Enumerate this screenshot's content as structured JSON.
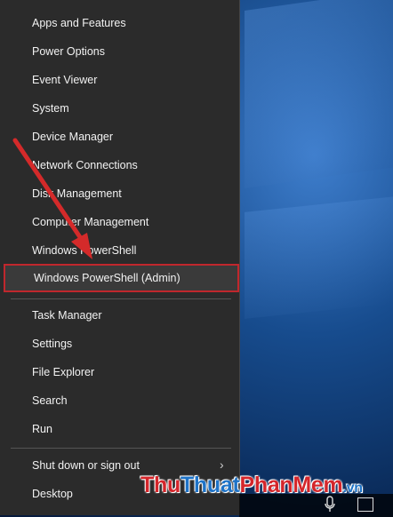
{
  "menu": {
    "items": [
      {
        "label": "Apps and Features",
        "name": "menu-item-apps-features"
      },
      {
        "label": "Power Options",
        "name": "menu-item-power-options"
      },
      {
        "label": "Event Viewer",
        "name": "menu-item-event-viewer"
      },
      {
        "label": "System",
        "name": "menu-item-system"
      },
      {
        "label": "Device Manager",
        "name": "menu-item-device-manager"
      },
      {
        "label": "Network Connections",
        "name": "menu-item-network-connections"
      },
      {
        "label": "Disk Management",
        "name": "menu-item-disk-management"
      },
      {
        "label": "Computer Management",
        "name": "menu-item-computer-management"
      },
      {
        "label": "Windows PowerShell",
        "name": "menu-item-windows-powershell"
      },
      {
        "label": "Windows PowerShell (Admin)",
        "name": "menu-item-windows-powershell-admin"
      },
      {
        "label": "Task Manager",
        "name": "menu-item-task-manager"
      },
      {
        "label": "Settings",
        "name": "menu-item-settings"
      },
      {
        "label": "File Explorer",
        "name": "menu-item-file-explorer"
      },
      {
        "label": "Search",
        "name": "menu-item-search"
      },
      {
        "label": "Run",
        "name": "menu-item-run"
      },
      {
        "label": "Shut down or sign out",
        "name": "menu-item-shutdown"
      },
      {
        "label": "Desktop",
        "name": "menu-item-desktop"
      }
    ],
    "highlight_color": "#c0272d",
    "chevron_icon": "chevron-right-icon"
  },
  "watermark": {
    "part1": "Thu",
    "part2": "Thuat",
    "part3": "PhanMem",
    "part4": ".vn"
  },
  "taskbar": {
    "icons": [
      "microphone-icon",
      "notification-icon"
    ]
  }
}
